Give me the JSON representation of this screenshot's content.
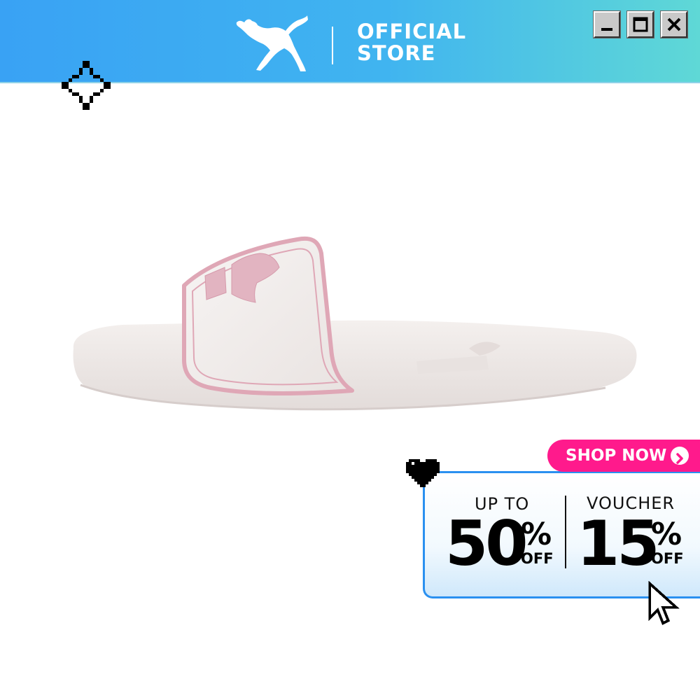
{
  "header": {
    "brand_logo": "puma-cat-logo",
    "store_line1": "OFFICIAL",
    "store_line2": "STORE",
    "window_controls": [
      "minimize",
      "maximize",
      "close"
    ],
    "gradient_colors": [
      "#39a2f4",
      "#5fd8d6"
    ]
  },
  "product": {
    "image": "pink-white-slide-sandal",
    "colors": {
      "body": "#f1ecea",
      "accent": "#dfa7b6"
    }
  },
  "promo": {
    "shop_now_label": "SHOP NOW",
    "shop_now_color": "#ff1a8c",
    "left_caption": "UP TO",
    "left_value": "50",
    "left_percent": "%",
    "left_suffix": "OFF",
    "right_caption": "VOUCHER",
    "right_value": "15",
    "right_percent": "%",
    "right_suffix": "OFF",
    "border_color": "#2a90f0"
  },
  "decorations": [
    "pixel-sparkle-icon",
    "pixel-heart-icon",
    "pixel-cursor-icon"
  ]
}
